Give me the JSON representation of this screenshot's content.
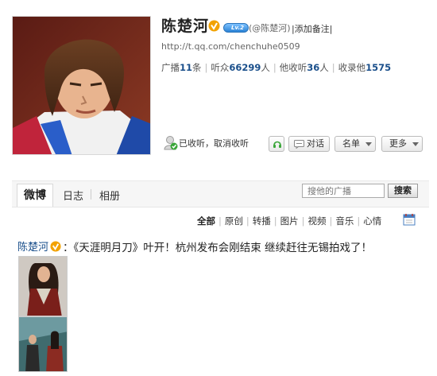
{
  "profile": {
    "name": "陈楚河",
    "handle": "(@陈楚河)",
    "remark_link": "|添加备注|",
    "level_badge": "Lv.2",
    "url": "http://t.qq.com/chenchuhe0509",
    "stats": [
      {
        "label": "广播",
        "value": "11",
        "unit": "条"
      },
      {
        "label": "听众",
        "value": "66299",
        "unit": "人"
      },
      {
        "label": "他收听",
        "value": "36",
        "unit": "人"
      },
      {
        "label": "收录他",
        "value": "1575",
        "unit": ""
      }
    ],
    "follow_status": "已收听，取消收听",
    "buttons": {
      "chat": "对话",
      "name_card": "名单",
      "more": "更多"
    }
  },
  "tabs": [
    {
      "label": "微博",
      "active": true
    },
    {
      "label": "日志",
      "active": false
    },
    {
      "label": "相册",
      "active": false
    }
  ],
  "search": {
    "placeholder": "搜他的广播",
    "button": "搜索"
  },
  "filters": [
    "全部",
    "原创",
    "转播",
    "图片",
    "视频",
    "音乐",
    "心情"
  ],
  "post": {
    "author": "陈楚河",
    "text": "：《天涯明月刀》叶开！杭州发布会刚结束  继续赶往无锡拍戏了！"
  },
  "colors": {
    "accent": "#1a4f8b",
    "vip": "#f2a200",
    "follow_green": "#3aa639"
  },
  "icons": [
    "verified-v-icon",
    "level-badge-icon",
    "person-followed-icon",
    "headset-icon",
    "chat-bubble-icon",
    "calendar-icon"
  ]
}
